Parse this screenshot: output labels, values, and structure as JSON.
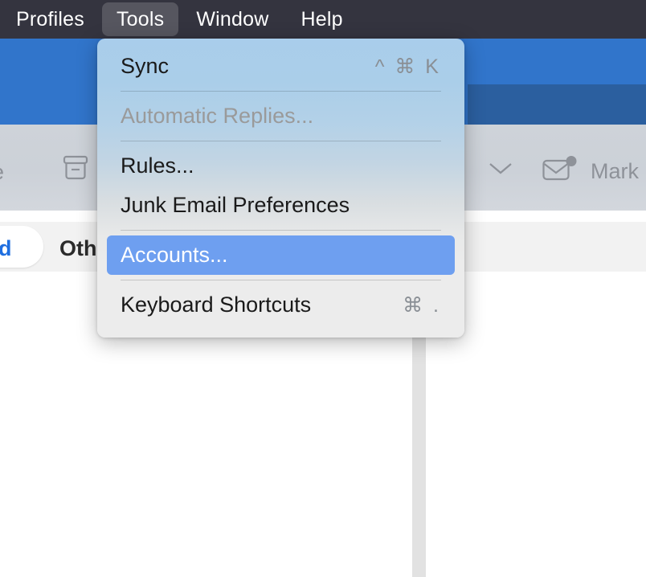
{
  "menubar": {
    "items": [
      {
        "label": "Profiles",
        "active": false
      },
      {
        "label": "Tools",
        "active": true
      },
      {
        "label": "Window",
        "active": false
      },
      {
        "label": "Help",
        "active": false
      }
    ]
  },
  "toolbar": {
    "left_truncated_label": "e",
    "archive_icon": "archive-icon",
    "chevron_icon": "chevron-down-icon",
    "envelope_icon": "envelope-unread-icon",
    "mark_label": "Mark"
  },
  "tabs": {
    "focused_label": "d",
    "other_label": "Othe"
  },
  "menu": {
    "title": "Tools",
    "items": [
      {
        "label": "Sync",
        "shortcut": "^ ⌘ K",
        "state": "normal"
      },
      {
        "label": "Automatic Replies...",
        "shortcut": "",
        "state": "disabled"
      },
      {
        "label": "Rules...",
        "shortcut": "",
        "state": "normal"
      },
      {
        "label": "Junk Email Preferences",
        "shortcut": "",
        "state": "normal"
      },
      {
        "label": "Accounts...",
        "shortcut": "",
        "state": "selected"
      },
      {
        "label": "Keyboard Shortcuts",
        "shortcut": "⌘ .",
        "state": "normal"
      }
    ]
  },
  "colors": {
    "menubar_bg": "#34343f",
    "menubar_active": "#56565f",
    "accent_blue": "#3175cb",
    "selection_blue": "#6e9ff0",
    "tab_active_text": "#1f6fe0",
    "menu_top": "#a9cdeb",
    "menu_bottom": "#ececec"
  }
}
